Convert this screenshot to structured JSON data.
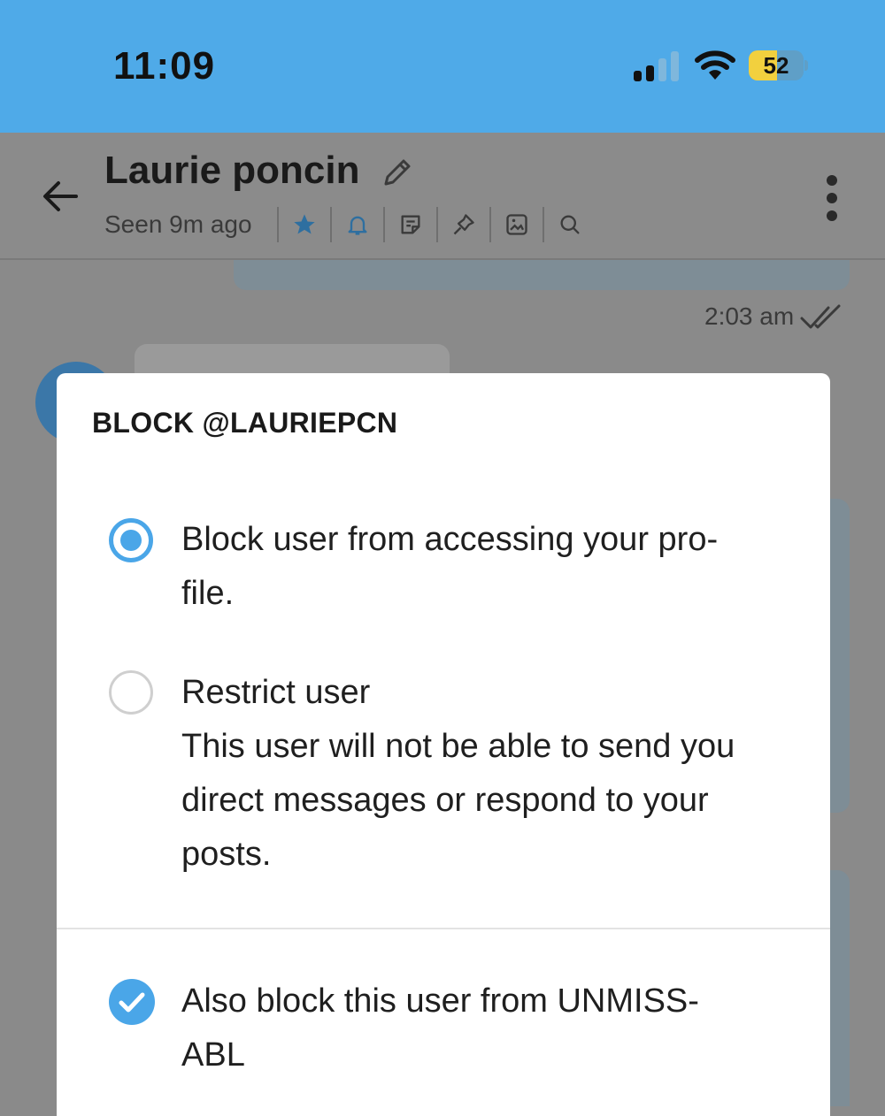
{
  "status_bar": {
    "time": "11:09",
    "battery": "52",
    "battery_level": 0.52,
    "signal_bars": 2,
    "bar_color": "#4FAAE8"
  },
  "header": {
    "title": "Laurie poncin",
    "subtitle": "Seen 9m ago",
    "icons": [
      "star-icon",
      "bell-icon",
      "note-icon",
      "pin-icon",
      "image-icon",
      "search-icon"
    ],
    "back_icon": "arrow-left-icon",
    "menu_icon": "more-vertical-icon"
  },
  "chat": {
    "timestamp": "2:03 am"
  },
  "dialog": {
    "title": "BLOCK @LAURIEPCN",
    "options": [
      {
        "label": "Block user from accessing your pro-",
        "label_cont": "file.",
        "selected": true
      },
      {
        "label": "Restrict user",
        "desc1": "This user will not be able to send you",
        "desc2": "direct messages or respond to your",
        "desc3": "posts.",
        "selected": false
      }
    ],
    "checkbox": {
      "label": "Also block this user from UNMISS-",
      "label_cont": "ABL",
      "checked": true
    },
    "accent_color": "#4AA6E8"
  }
}
